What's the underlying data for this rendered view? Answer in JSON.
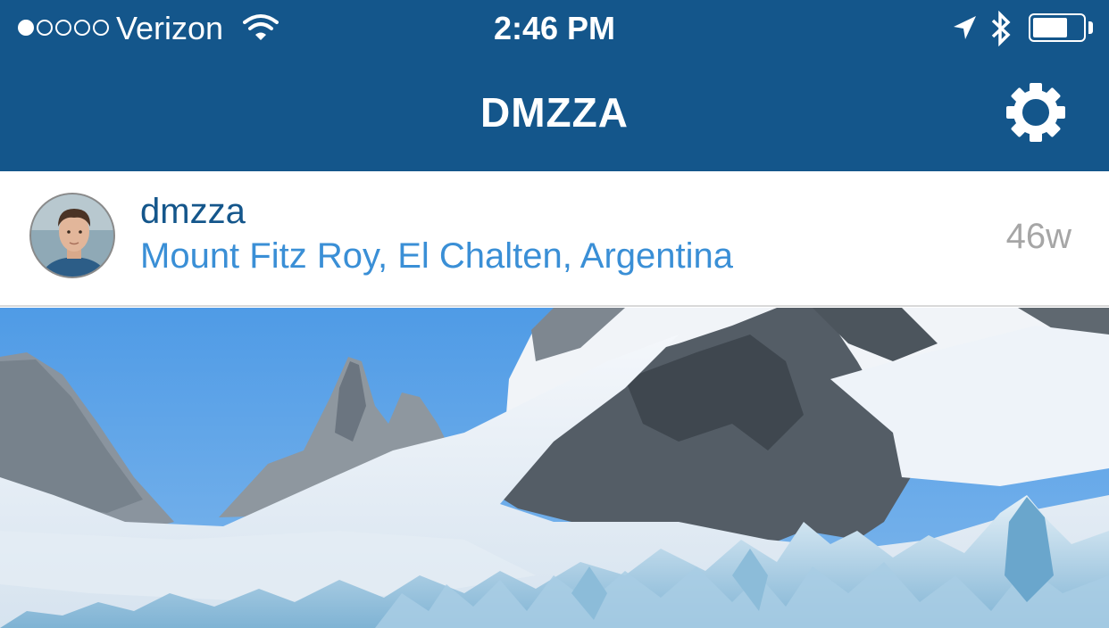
{
  "status_bar": {
    "carrier": "Verizon",
    "signal_bars_filled": 1,
    "signal_bars_total": 5,
    "time": "2:46 PM",
    "battery_level": 0.7,
    "icons": [
      "wifi-icon",
      "location-arrow-icon",
      "bluetooth-icon",
      "battery-icon"
    ]
  },
  "nav": {
    "title": "DMZZA",
    "settings_icon": "gear-icon"
  },
  "post": {
    "username": "dmzza",
    "location": "Mount Fitz Roy, El Chalten, Argentina",
    "age": "46w"
  },
  "colors": {
    "header_bg": "#14568b",
    "username": "#14568b",
    "location_link": "#3a8fd6",
    "timestamp": "#a6a6a6"
  }
}
